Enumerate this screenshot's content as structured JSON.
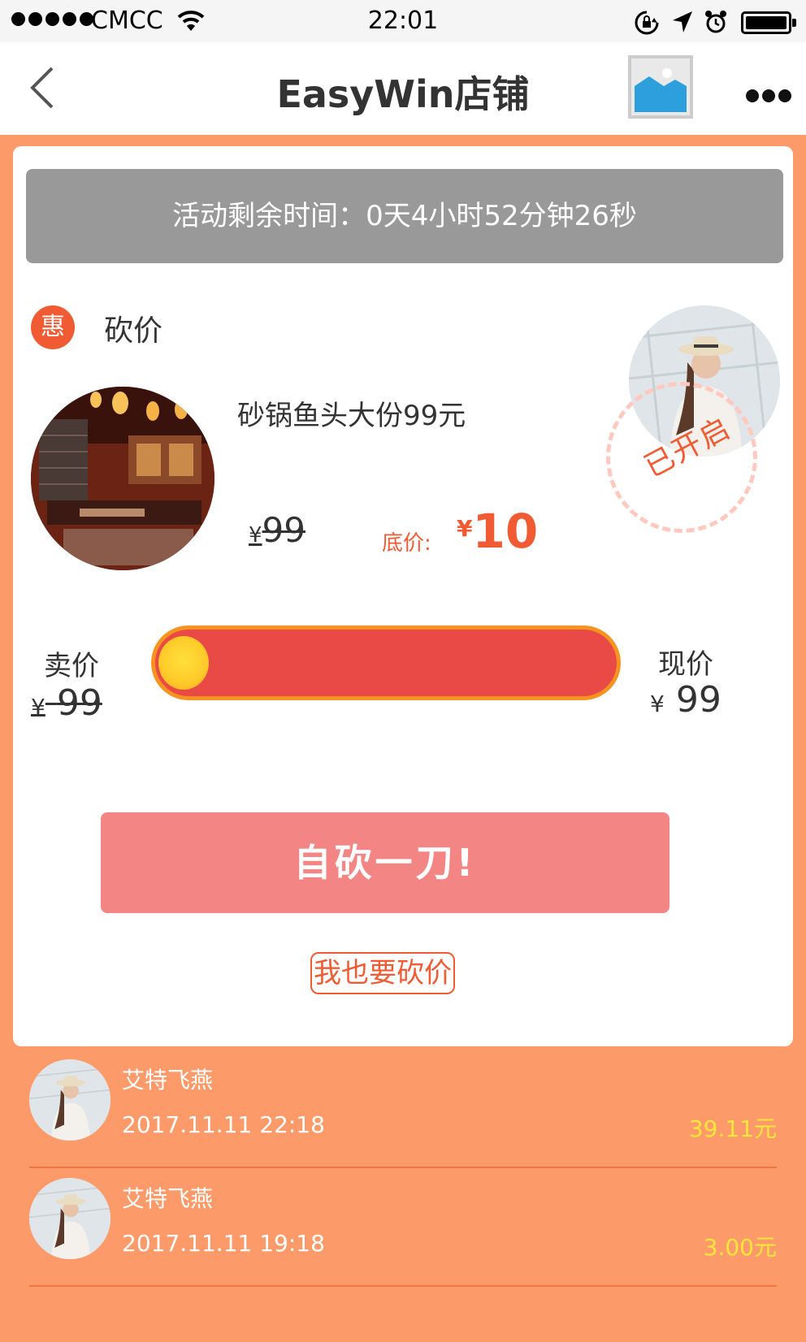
{
  "status_bar": {
    "carrier": "CMCC",
    "time": "22:01"
  },
  "nav": {
    "title": "EasyWin店铺",
    "back_icon": "chevron-left-icon",
    "more_icon": "more-dots-icon",
    "thumb_icon": "image-placeholder-icon"
  },
  "card": {
    "timer_text": "活动剩余时间：0天4小时52分钟26秒",
    "tag_badge": "惠",
    "tag_label": "砍价",
    "stamp_text": "已开启",
    "product_name": "砂锅鱼头大份99元",
    "original_price": {
      "yen": "¥",
      "value": "99"
    },
    "floor_label": "底价:",
    "floor_price": {
      "yen": "¥",
      "value": "10"
    },
    "sell_label": "卖价",
    "sell_price": {
      "yen": "¥",
      "value": "99"
    },
    "now_label": "现价",
    "now_price": {
      "yen": "¥",
      "value": "99"
    },
    "progress_percent": 0,
    "cut_button": "自砍一刀!",
    "me_too_button": "我也要砍价"
  },
  "records": [
    {
      "name": "艾特飞燕",
      "time": "2017.11.11 22:18",
      "amount": "39.11元"
    },
    {
      "name": "艾特飞燕",
      "time": "2017.11.11 19:18",
      "amount": "3.00元"
    }
  ],
  "colors": {
    "page_bg": "#fd9a6a",
    "accent": "#f05b33",
    "progress_fill": "#ea4a46",
    "progress_border": "#f7931f",
    "button": "#f38585",
    "amount": "#ffe63b",
    "timer_bg": "#999999"
  }
}
